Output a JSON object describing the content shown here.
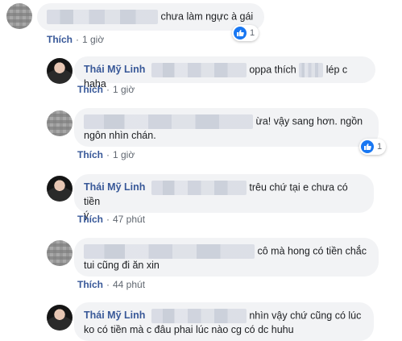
{
  "comments": [
    {
      "author": "",
      "text_after": "chưa làm ngực à gái",
      "meta": {
        "like": "Thích",
        "sep": "·",
        "time": "1 giờ"
      },
      "reactions": "1"
    },
    {
      "author": "Thái Mỹ Linh",
      "text_after": "oppa thích",
      "text_after2": "lép c haha",
      "meta": {
        "like": "Thích",
        "sep": "·",
        "time": "1 giờ"
      }
    },
    {
      "author": "",
      "text_after": "ừa! vậy sang hơn. ngồn",
      "line2": "ngôn nhìn chán.",
      "meta": {
        "like": "Thích",
        "sep": "·",
        "time": "1 giờ"
      },
      "reactions": "1"
    },
    {
      "author": "Thái Mỹ Linh",
      "text_after": "trêu chứ tại e chưa có tiền",
      "line2": "ý",
      "meta": {
        "like": "Thích",
        "sep": "·",
        "time": "47 phút"
      }
    },
    {
      "author": "",
      "text_after": "cô mà hong có tiền chắc",
      "line2": "tui cũng đi ăn xin",
      "meta": {
        "like": "Thích",
        "sep": "·",
        "time": "44 phút"
      }
    },
    {
      "author": "Thái Mỹ Linh",
      "text_after": "nhìn vậy chứ cũng có lúc",
      "line2": "ko có tiền mà c đâu phai lúc nào cg có dc huhu"
    }
  ],
  "colors": {
    "link": "#385898",
    "bubble": "#f2f3f5",
    "like_blue": "#1877f2",
    "meta": "#606770"
  }
}
